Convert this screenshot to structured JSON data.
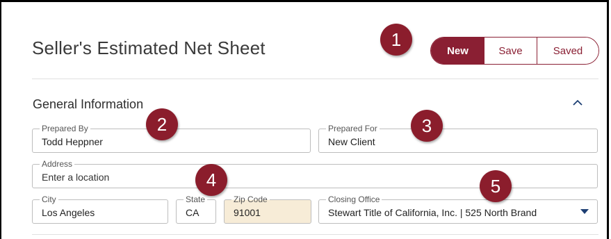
{
  "page": {
    "title": "Seller's Estimated Net Sheet"
  },
  "actions": {
    "new_label": "New",
    "save_label": "Save",
    "saved_label": "Saved"
  },
  "general": {
    "section_title": "General Information",
    "collapse_icon": "chevron-up-icon",
    "prepared_by": {
      "label": "Prepared By",
      "value": "Todd Heppner"
    },
    "prepared_for": {
      "label": "Prepared For",
      "value": "New Client"
    },
    "address": {
      "label": "Address",
      "value": "Enter a location"
    },
    "city": {
      "label": "City",
      "value": "Los Angeles"
    },
    "state": {
      "label": "State",
      "value": "CA"
    },
    "zip": {
      "label": "Zip Code",
      "value": "91001"
    },
    "closing_office": {
      "label": "Closing Office",
      "value": "Stewart Title of California, Inc. | 525 North Brand"
    }
  },
  "callouts": [
    "1",
    "2",
    "3",
    "4",
    "5"
  ],
  "colors": {
    "brand": "#8a1f33",
    "callout": "#8b1d2c",
    "readonly_field": "#f7ecd7",
    "select_caret": "#1d3f73"
  }
}
